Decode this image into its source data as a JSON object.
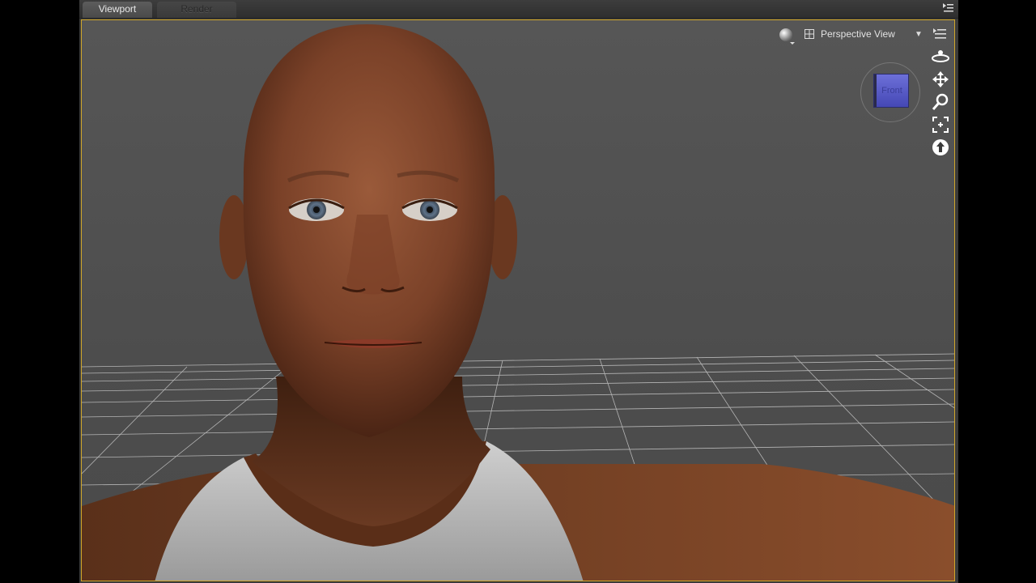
{
  "tabs": [
    {
      "label": "Viewport",
      "active": true
    },
    {
      "label": "Render Library",
      "active": false
    }
  ],
  "viewport": {
    "camera_label": "Perspective View",
    "view_cube_face": "Front",
    "accent_color": "#d1a72a"
  },
  "nav_tools": [
    "orbit-icon",
    "pan-icon",
    "zoom-icon",
    "frame-icon",
    "reset-view-icon"
  ]
}
